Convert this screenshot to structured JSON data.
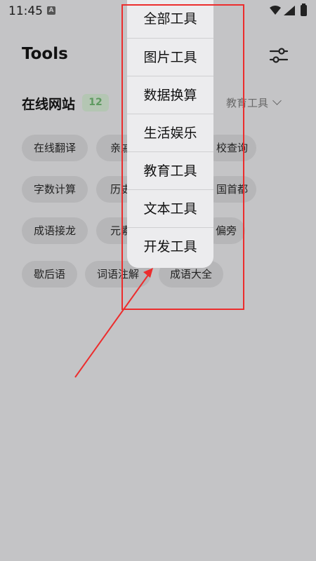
{
  "status_bar": {
    "time": "11:45",
    "notif_glyph": "A"
  },
  "header": {
    "title": "Tools",
    "filter_icon": "sliders-icon"
  },
  "section": {
    "title": "在线网站",
    "count": "12",
    "category": "教育工具"
  },
  "chips": [
    {
      "label": "在线翻译"
    },
    {
      "label": "亲戚"
    },
    {
      "label": "校查询"
    },
    {
      "label": "字数计算"
    },
    {
      "label": "历史"
    },
    {
      "label": "国首都"
    },
    {
      "label": "成语接龙"
    },
    {
      "label": "元素"
    },
    {
      "label": "偏旁"
    },
    {
      "label": "歇后语"
    },
    {
      "label": "词语注解"
    },
    {
      "label": "成语大全"
    }
  ],
  "menu": {
    "items": [
      {
        "label": "全部工具"
      },
      {
        "label": "图片工具"
      },
      {
        "label": "数据换算"
      },
      {
        "label": "生活娱乐"
      },
      {
        "label": "教育工具"
      },
      {
        "label": "文本工具"
      },
      {
        "label": "开发工具"
      }
    ]
  },
  "colors": {
    "annotation": "#ec2d2d",
    "badge_text": "#5e9a60"
  }
}
